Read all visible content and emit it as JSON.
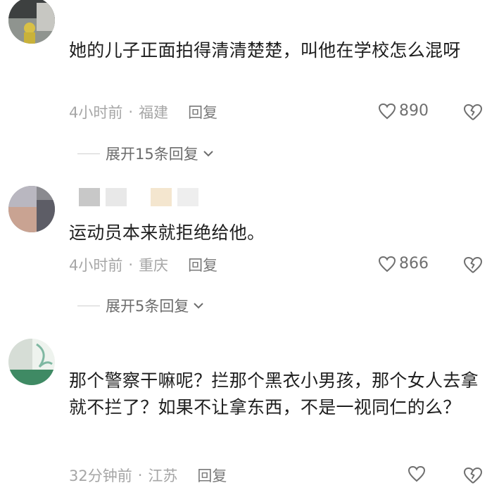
{
  "comments": [
    {
      "text": "她的儿子正面拍得清清楚楚，叫他在学校怎么混呀",
      "time": "4小时前",
      "separator": "·",
      "location": "福建",
      "reply_label": "回复",
      "likes": "890",
      "expand_label": "展开15条回复"
    },
    {
      "text": "运动员本来就拒绝给他。",
      "time": "4小时前",
      "separator": "·",
      "location": "重庆",
      "reply_label": "回复",
      "likes": "866",
      "expand_label": "展开5条回复"
    },
    {
      "text": "那个警察干嘛呢？拦那个黑衣小男孩，那个女人去拿就不拦了？如果不让拿东西，不是一视同仁的么？",
      "time": "32分钟前",
      "separator": "·",
      "location": "江苏",
      "reply_label": "回复",
      "likes": ""
    }
  ],
  "icons": {
    "like": "heart-outline-icon",
    "dislike": "broken-heart-icon",
    "expand": "chevron-down-icon"
  },
  "colors": {
    "meta_text": "#a6a6a6",
    "body_text": "#1e1e1e",
    "icon": "#6f6f6f"
  }
}
